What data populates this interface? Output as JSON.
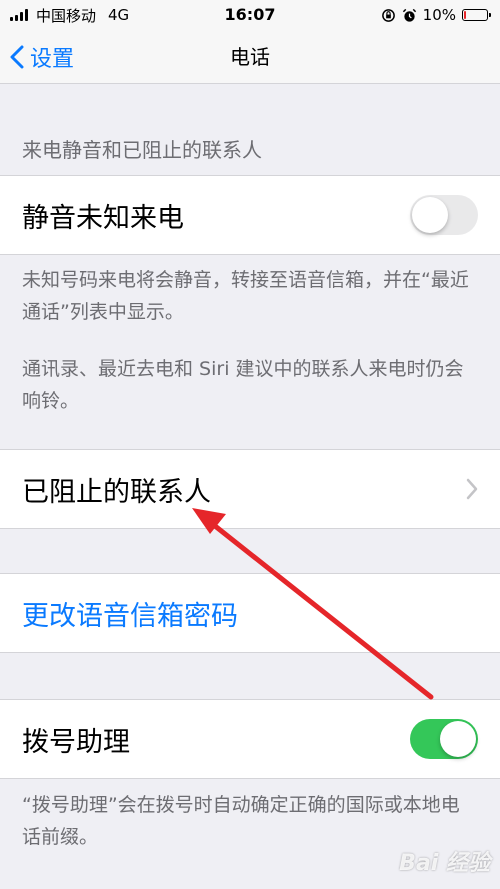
{
  "status_bar": {
    "carrier": "中国移动",
    "network": "4G",
    "time": "16:07",
    "battery_percent": "10%",
    "battery_level": 0.1,
    "battery_color": "#e5262a"
  },
  "nav": {
    "back_label": "设置",
    "title": "电话"
  },
  "section_header": "来电静音和已阻止的联系人",
  "silence_unknown": {
    "label": "静音未知来电",
    "enabled": false
  },
  "silence_footer": {
    "line1": "未知号码来电将会静音，转接至语音信箱，并在“最近通话”列表中显示。",
    "line2": "通讯录、最近去电和 Siri 建议中的联系人来电时仍会响铃。"
  },
  "blocked_contacts": {
    "label": "已阻止的联系人"
  },
  "change_voicemail": {
    "label": "更改语音信箱密码"
  },
  "dial_assist": {
    "label": "拨号助理",
    "enabled": true,
    "footer": "“拨号助理”会在拨号时自动确定正确的国际或本地电话前缀。"
  },
  "watermark": "Bai 经验",
  "colors": {
    "accent": "#0a7aff",
    "toggle_on": "#34c759",
    "annotation_arrow": "#e5262a"
  }
}
